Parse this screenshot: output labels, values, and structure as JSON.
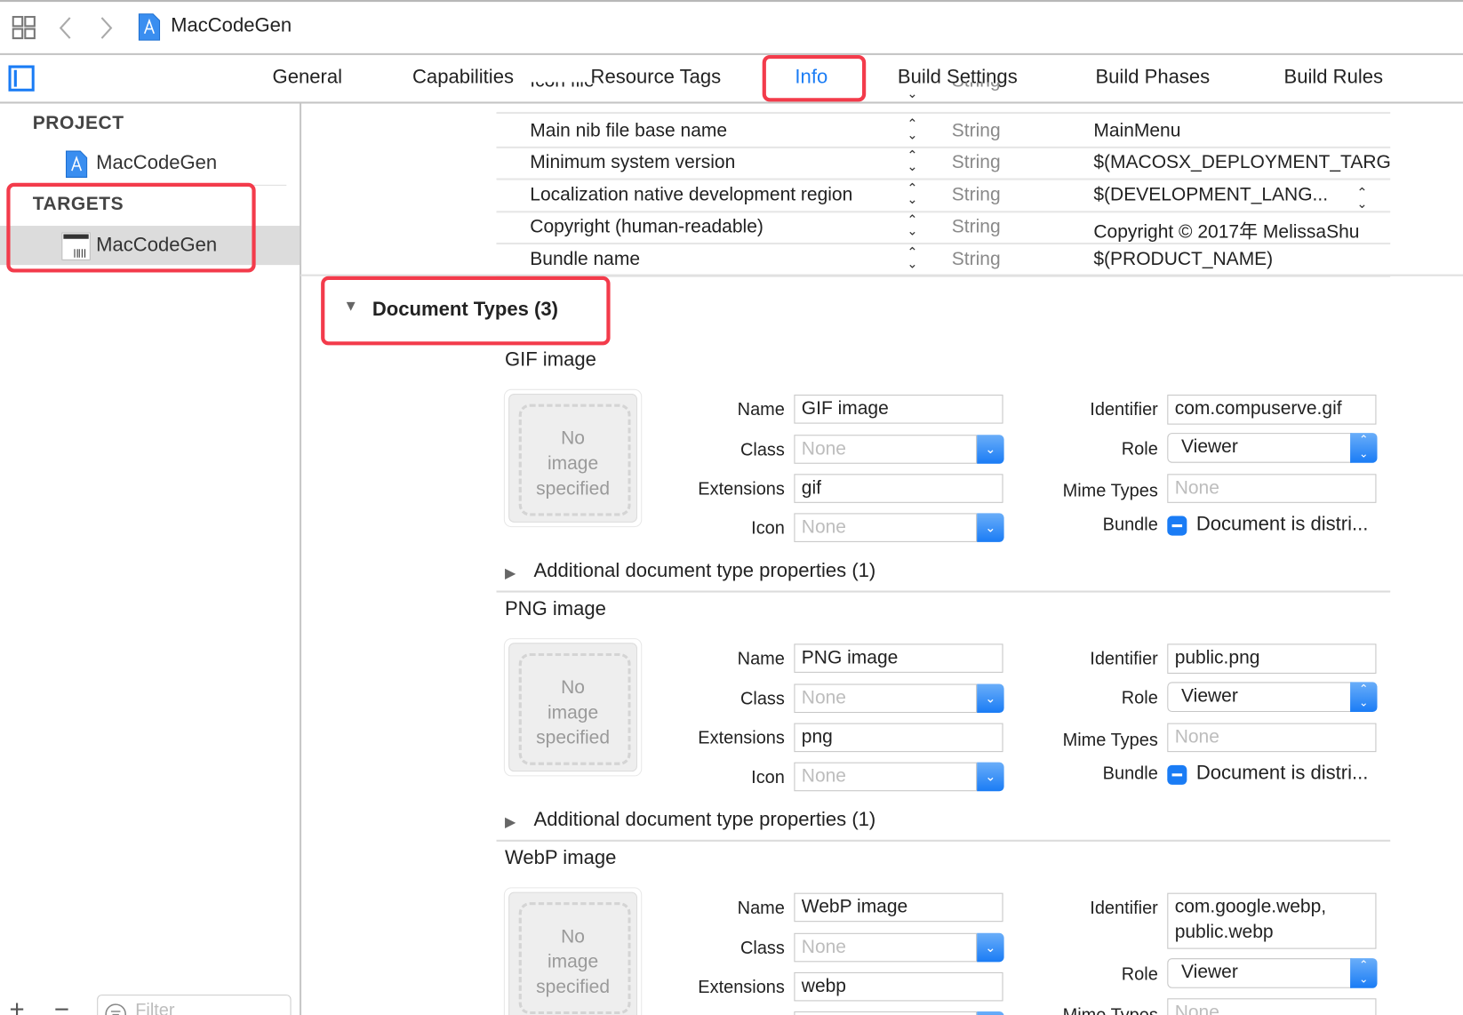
{
  "toolbar": {
    "title": "MacCodeGen"
  },
  "tabs": [
    {
      "label": "General"
    },
    {
      "label": "Capabilities"
    },
    {
      "label": "Resource Tags"
    },
    {
      "label": "Info",
      "active": true
    },
    {
      "label": "Build Settings"
    },
    {
      "label": "Build Phases"
    },
    {
      "label": "Build Rules"
    }
  ],
  "sidebar": {
    "project_header": "PROJECT",
    "project_item": "MacCodeGen",
    "targets_header": "TARGETS",
    "target_item": "MacCodeGen",
    "filter_placeholder": "Filter"
  },
  "info_rows": [
    {
      "key": "Icon file",
      "type": "String",
      "value": ""
    },
    {
      "key": "Main nib file base name",
      "type": "String",
      "value": "MainMenu"
    },
    {
      "key": "Minimum system version",
      "type": "String",
      "value": "$(MACOSX_DEPLOYMENT_TARGET)"
    },
    {
      "key": "Localization native development region",
      "type": "String",
      "value": "$(DEVELOPMENT_LANG..."
    },
    {
      "key": "Copyright (human-readable)",
      "type": "String",
      "value": "Copyright © 2017年 MelissaShu"
    },
    {
      "key": "Bundle name",
      "type": "String",
      "value": "$(PRODUCT_NAME)"
    }
  ],
  "document_types": {
    "header": "Document Types (3)",
    "labels": {
      "name": "Name",
      "class": "Class",
      "extensions": "Extensions",
      "icon": "Icon",
      "identifier": "Identifier",
      "role": "Role",
      "mime": "Mime Types",
      "bundle": "Bundle"
    },
    "no_image": [
      "No",
      "image",
      "specified"
    ],
    "placeholder": "None",
    "additional": "Additional document type properties (1)",
    "items": [
      {
        "title": "GIF image",
        "name": "GIF image",
        "extensions": "gif",
        "identifier": "com.compuserve.gif",
        "role": "Viewer",
        "bundle": "Document is distri..."
      },
      {
        "title": "PNG image",
        "name": "PNG image",
        "extensions": "png",
        "identifier": "public.png",
        "role": "Viewer",
        "bundle": "Document is distri..."
      },
      {
        "title": "WebP image",
        "name": "WebP image",
        "extensions": "webp",
        "identifier": "com.google.webp, public.webp",
        "role": "Viewer",
        "bundle": ""
      }
    ]
  },
  "colors": {
    "accent": "#1a7cf5",
    "highlight": "#f33b4b"
  }
}
